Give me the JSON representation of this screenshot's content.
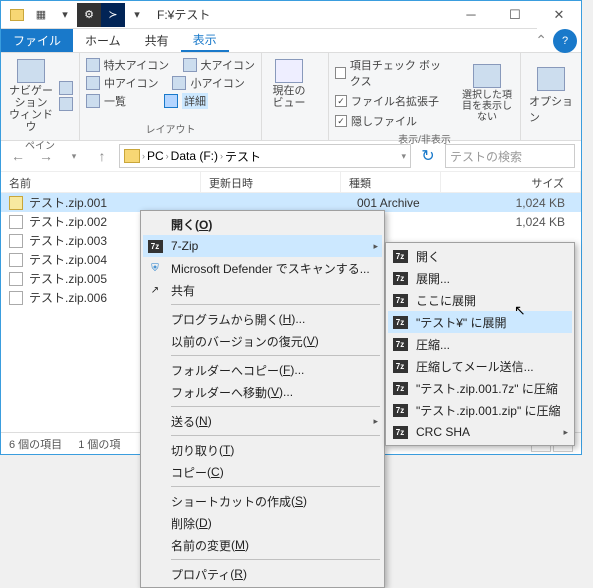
{
  "title": "F:¥テスト",
  "tabs": {
    "file": "ファイル",
    "home": "ホーム",
    "share": "共有",
    "view": "表示"
  },
  "ribbon": {
    "pane": {
      "nav_window": "ナビゲーション ウィンドウ",
      "label": "ペイン"
    },
    "layout": {
      "xlarge": "特大アイコン",
      "large": "大アイコン",
      "medium": "中アイコン",
      "small": "小アイコン",
      "list": "一覧",
      "details": "詳細",
      "label": "レイアウト"
    },
    "current": {
      "btn": "現在のビュー",
      "label": "現在のビュー"
    },
    "showhide": {
      "checkboxes": "項目チェック ボックス",
      "extensions": "ファイル名拡張子",
      "hidden": "隠しファイル",
      "no_show_selected": "選択した項目を表示しない",
      "label": "表示/非表示"
    },
    "options": "オプション"
  },
  "breadcrumb": [
    "PC",
    "Data (F:)",
    "テスト"
  ],
  "search_placeholder": "テストの検索",
  "columns": {
    "name": "名前",
    "date": "更新日時",
    "type": "種類",
    "size": "サイズ"
  },
  "files": [
    {
      "name": "テスト.zip.001",
      "type": "001 Archive",
      "size": "1,024 KB",
      "selected": true
    },
    {
      "name": "テスト.zip.002",
      "size": "1,024 KB"
    },
    {
      "name": "テスト.zip.003"
    },
    {
      "name": "テスト.zip.004"
    },
    {
      "name": "テスト.zip.005"
    },
    {
      "name": "テスト.zip.006"
    }
  ],
  "status": {
    "count": "6 個の項目",
    "selection": "1 個の項"
  },
  "contextmenu1": {
    "open": "開く",
    "open_hotkey": "O",
    "sevenzip": "7-Zip",
    "defender": "Microsoft Defender でスキャンする...",
    "share": "共有",
    "open_with": "プログラムから開く",
    "open_with_hotkey": "H",
    "prev_versions": "以前のバージョンの復元",
    "prev_versions_hotkey": "V",
    "send_folder_copy": "フォルダーへコピー",
    "send_folder_copy_hotkey": "F",
    "send_folder_move": "フォルダーへ移動",
    "send_folder_move_hotkey": "V",
    "send_to": "送る",
    "send_to_hotkey": "N",
    "cut": "切り取り",
    "cut_hotkey": "T",
    "copy": "コピー",
    "copy_hotkey": "C",
    "create_shortcut": "ショートカットの作成",
    "create_shortcut_hotkey": "S",
    "delete": "削除",
    "delete_hotkey": "D",
    "rename": "名前の変更",
    "rename_hotkey": "M",
    "properties": "プロパティ",
    "properties_hotkey": "R"
  },
  "contextmenu2": {
    "open": "開く",
    "extract": "展開...",
    "extract_here": "ここに展開",
    "extract_to": "\"テスト¥\" に展開",
    "compress": "圧縮...",
    "compress_mail": "圧縮してメール送信...",
    "compress_7z": "\"テスト.zip.001.7z\" に圧縮",
    "compress_zip": "\"テスト.zip.001.zip\" に圧縮",
    "crc_sha": "CRC SHA"
  }
}
